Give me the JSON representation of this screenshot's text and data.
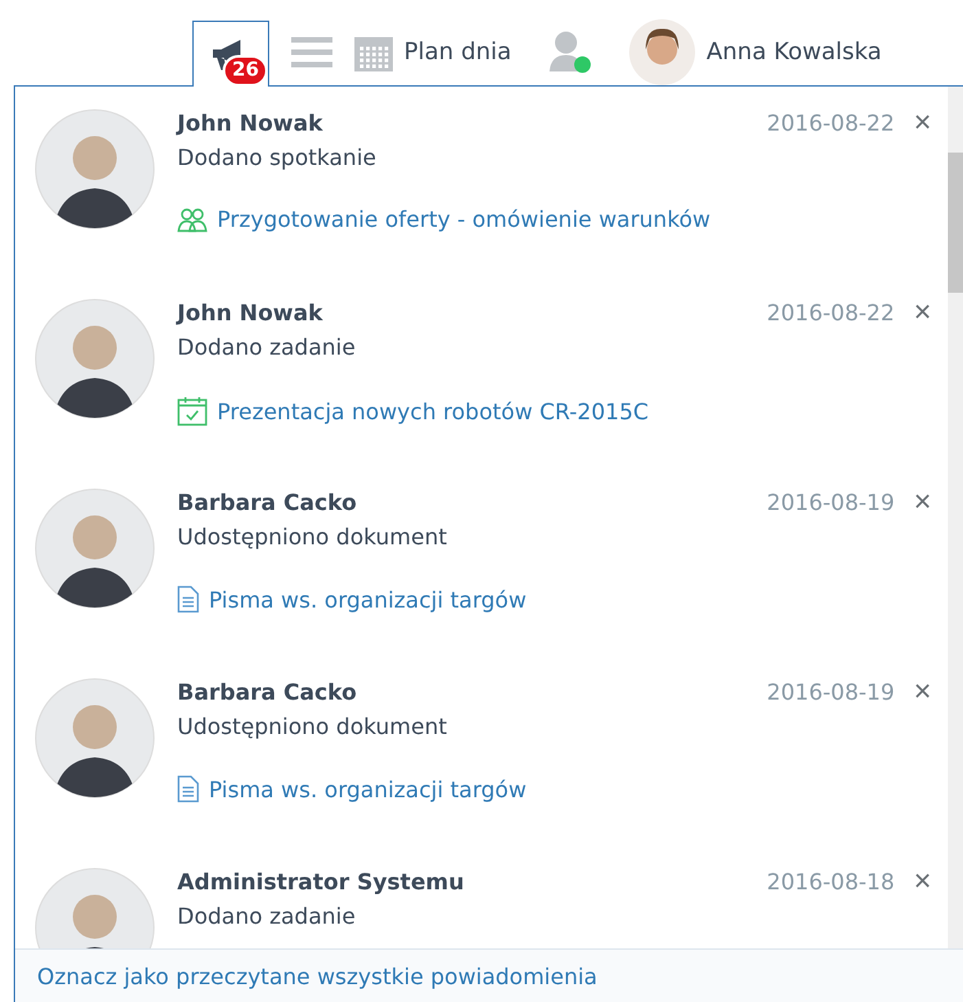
{
  "topbar": {
    "notifications": {
      "count": "26",
      "selected": true
    },
    "plan_label": "Plan dnia",
    "user_name": "Anna Kowalska"
  },
  "notifications": [
    {
      "author": "John Nowak",
      "action": "Dodano spotkanie",
      "date": "2016-08-22",
      "close": "×",
      "link": {
        "kind": "meeting",
        "text": "Przygotowanie oferty - omówienie warunków"
      }
    },
    {
      "author": "John Nowak",
      "action": "Dodano zadanie",
      "date": "2016-08-22",
      "close": "×",
      "link": {
        "kind": "task",
        "text": "Prezentacja nowych robotów CR-2015C"
      }
    },
    {
      "author": "Barbara Cacko",
      "action": "Udostępniono dokument",
      "date": "2016-08-19",
      "close": "×",
      "link": {
        "kind": "document",
        "text": "Pisma ws. organizacji targów"
      }
    },
    {
      "author": "Barbara Cacko",
      "action": "Udostępniono dokument",
      "date": "2016-08-19",
      "close": "×",
      "link": {
        "kind": "document",
        "text": "Pisma ws. organizacji targów"
      }
    },
    {
      "author": "Administrator Systemu",
      "action": "Dodano zadanie",
      "date": "2016-08-18",
      "close": "×"
    }
  ],
  "footer": {
    "mark_all_read": "Oznacz jako przeczytane wszystkie powiadomienia"
  }
}
